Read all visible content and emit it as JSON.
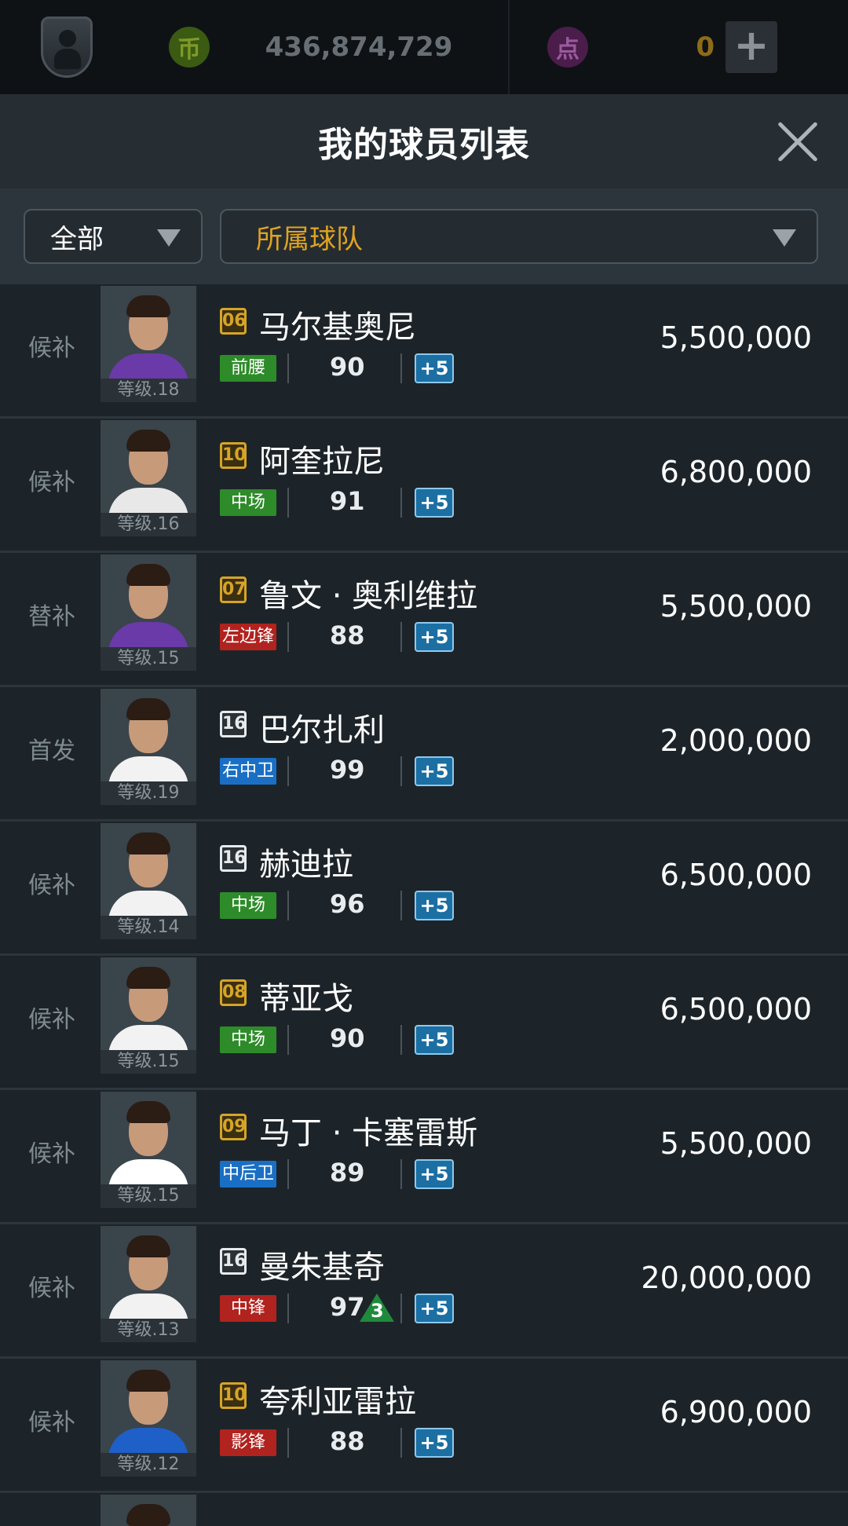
{
  "topbar": {
    "coin_icon_label": "币",
    "coins": "436,874,729",
    "point_icon_label": "点",
    "points": "0",
    "plus_label": "+"
  },
  "header": {
    "title": "我的球员列表"
  },
  "filters": {
    "category": "全部",
    "team": "所属球队"
  },
  "colors": {
    "pos_green": "#2e8b2a",
    "pos_red": "#b1231f",
    "pos_blue": "#1a6fc4",
    "badge_gold": "#d6a427",
    "plus_blue": "#1b6fa3"
  },
  "players": [
    {
      "status": "候补",
      "level": "等级.18",
      "number": "06",
      "number_style": "gold",
      "name": "马尔基奥尼",
      "position": "前腰",
      "position_color": "green",
      "ovr": "90",
      "boost": "+5",
      "price": "5,500,000"
    },
    {
      "status": "候补",
      "level": "等级.16",
      "number": "10",
      "number_style": "gold",
      "name": "阿奎拉尼",
      "position": "中场",
      "position_color": "green",
      "ovr": "91",
      "boost": "+5",
      "price": "6,800,000"
    },
    {
      "status": "替补",
      "level": "等级.15",
      "number": "07",
      "number_style": "gold",
      "name": "鲁文 · 奥利维拉",
      "position": "左边锋",
      "position_color": "red",
      "ovr": "88",
      "boost": "+5",
      "price": "5,500,000"
    },
    {
      "status": "首发",
      "level": "等级.19",
      "number": "16",
      "number_style": "white",
      "name": "巴尔扎利",
      "position": "右中卫",
      "position_color": "blue",
      "ovr": "99",
      "boost": "+5",
      "price": "2,000,000"
    },
    {
      "status": "候补",
      "level": "等级.14",
      "number": "16",
      "number_style": "white",
      "name": "赫迪拉",
      "position": "中场",
      "position_color": "green",
      "ovr": "96",
      "boost": "+5",
      "price": "6,500,000"
    },
    {
      "status": "候补",
      "level": "等级.15",
      "number": "08",
      "number_style": "gold",
      "name": "蒂亚戈",
      "position": "中场",
      "position_color": "green",
      "ovr": "90",
      "boost": "+5",
      "price": "6,500,000"
    },
    {
      "status": "候补",
      "level": "等级.15",
      "number": "09",
      "number_style": "gold",
      "name": "马丁 · 卡塞雷斯",
      "position": "中后卫",
      "position_color": "blue",
      "ovr": "89",
      "boost": "+5",
      "price": "5,500,000"
    },
    {
      "status": "候补",
      "level": "等级.13",
      "number": "16",
      "number_style": "white",
      "name": "曼朱基奇",
      "position": "中锋",
      "position_color": "red",
      "ovr": "97",
      "upgrade": "3",
      "boost": "+5",
      "price": "20,000,000"
    },
    {
      "status": "候补",
      "level": "等级.12",
      "number": "10",
      "number_style": "gold",
      "name": "夸利亚雷拉",
      "position": "影锋",
      "position_color": "red",
      "ovr": "88",
      "boost": "+5",
      "price": "6,900,000"
    }
  ]
}
